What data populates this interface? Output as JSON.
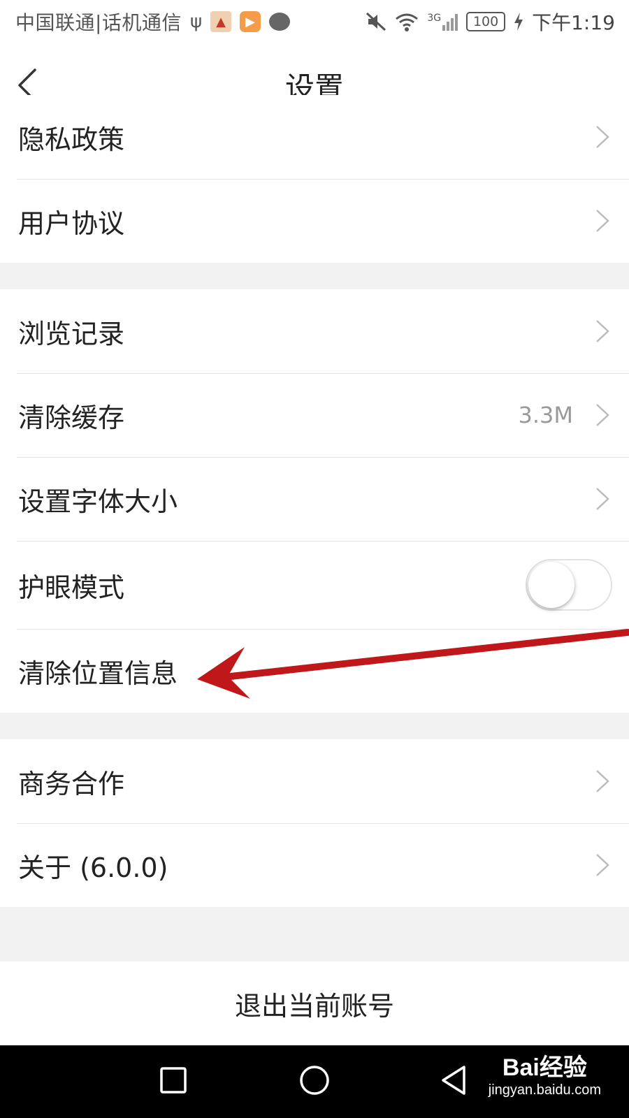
{
  "status_bar": {
    "carrier": "中国联通|话机通信",
    "network": "3G",
    "battery": "100",
    "time": "下午1:19"
  },
  "header": {
    "title": "设置"
  },
  "groups": [
    {
      "items": [
        {
          "label": "隐私政策",
          "type": "link"
        },
        {
          "label": "用户协议",
          "type": "link"
        }
      ]
    },
    {
      "items": [
        {
          "label": "浏览记录",
          "type": "link"
        },
        {
          "label": "清除缓存",
          "type": "link",
          "value": "3.3M"
        },
        {
          "label": "设置字体大小",
          "type": "link"
        },
        {
          "label": "护眼模式",
          "type": "toggle",
          "on": false
        },
        {
          "label": "清除位置信息",
          "type": "plain"
        }
      ]
    },
    {
      "items": [
        {
          "label": "商务合作",
          "type": "link"
        },
        {
          "label": "关于 (6.0.0)",
          "type": "link"
        }
      ]
    }
  ],
  "logout_label": "退出当前账号",
  "watermark": {
    "main": "Bai经验",
    "sub": "jingyan.baidu.com"
  },
  "colors": {
    "annotation_arrow": "#c0181a",
    "separator_band": "#f2f2f2",
    "secondary_text": "#999999"
  }
}
